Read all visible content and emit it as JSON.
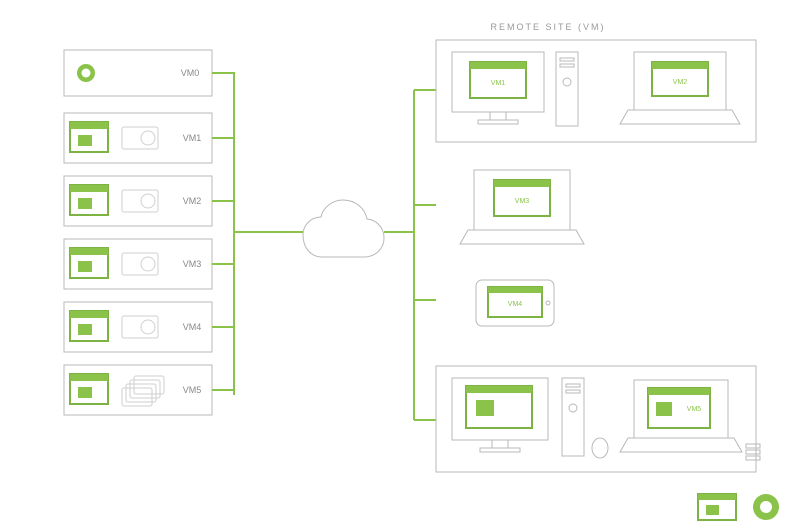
{
  "title": "REMOTE SITE (VM)",
  "host": {
    "label": "VM0"
  },
  "vms": [
    {
      "label": "VM1"
    },
    {
      "label": "VM2"
    },
    {
      "label": "VM3"
    },
    {
      "label": "VM4"
    },
    {
      "label": "VM5"
    }
  ],
  "remote": {
    "top": {
      "desktop": {
        "label": "VM1"
      },
      "laptop": {
        "label": "VM2"
      }
    },
    "mid_laptop": {
      "label": "VM3"
    },
    "tablet": {
      "label": "VM4"
    },
    "bottom": {
      "desktop": {
        "label": ""
      },
      "laptop": {
        "label": "VM5"
      }
    }
  },
  "footer_icons": {
    "app": "app-window-icon",
    "ring": "nvidia-ring-icon"
  }
}
